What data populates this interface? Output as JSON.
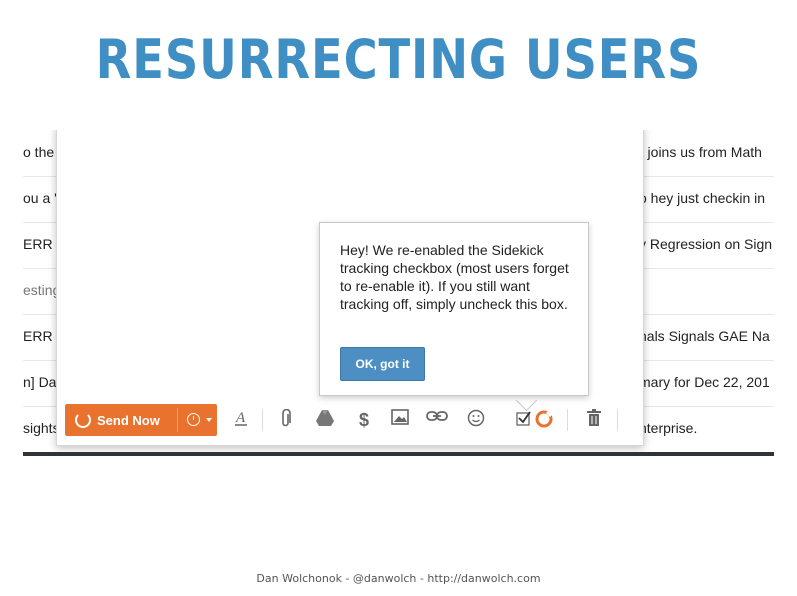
{
  "slide": {
    "title": "RESURRECTING USERS",
    "footer": "Dan Wolchonok - @danwolch - http://danwolch.com"
  },
  "inbox_rows": [
    {
      "left": "o the",
      "right": "r joins us from Math",
      "muted": false
    },
    {
      "left": "ou a '",
      "right": "o hey just checkin in",
      "muted": false
    },
    {
      "left": " ERR",
      "right": "y Regression on Sign",
      "muted": false
    },
    {
      "left": "esting",
      "right": "",
      "muted": true
    },
    {
      "left": " ERR",
      "right": "nals Signals GAE Na",
      "muted": false
    },
    {
      "left": "n] Da",
      "right": "mary for Dec 22, 201",
      "muted": false
    },
    {
      "left": "sights",
      "right": "nterprise.",
      "muted": false
    }
  ],
  "toolbar": {
    "send_label": "Send Now",
    "icons": [
      "send-spinner-icon",
      "schedule-clock-icon",
      "dropdown-caret-icon",
      "text-format-icon",
      "attachment-icon",
      "google-drive-icon",
      "money-icon",
      "insert-photo-icon",
      "link-icon",
      "emoji-icon",
      "tracking-checkbox-icon",
      "sidekick-logo-icon",
      "trash-icon"
    ]
  },
  "popover": {
    "message": "Hey! We re-enabled the Sidekick tracking checkbox (most users forget to re-enable it).  If you still want tracking off, simply uncheck this box.",
    "button_label": "OK, got it"
  },
  "colors": {
    "title": "#3f8fc5",
    "send_button": "#e8722e",
    "popover_button": "#4e8fc3"
  }
}
